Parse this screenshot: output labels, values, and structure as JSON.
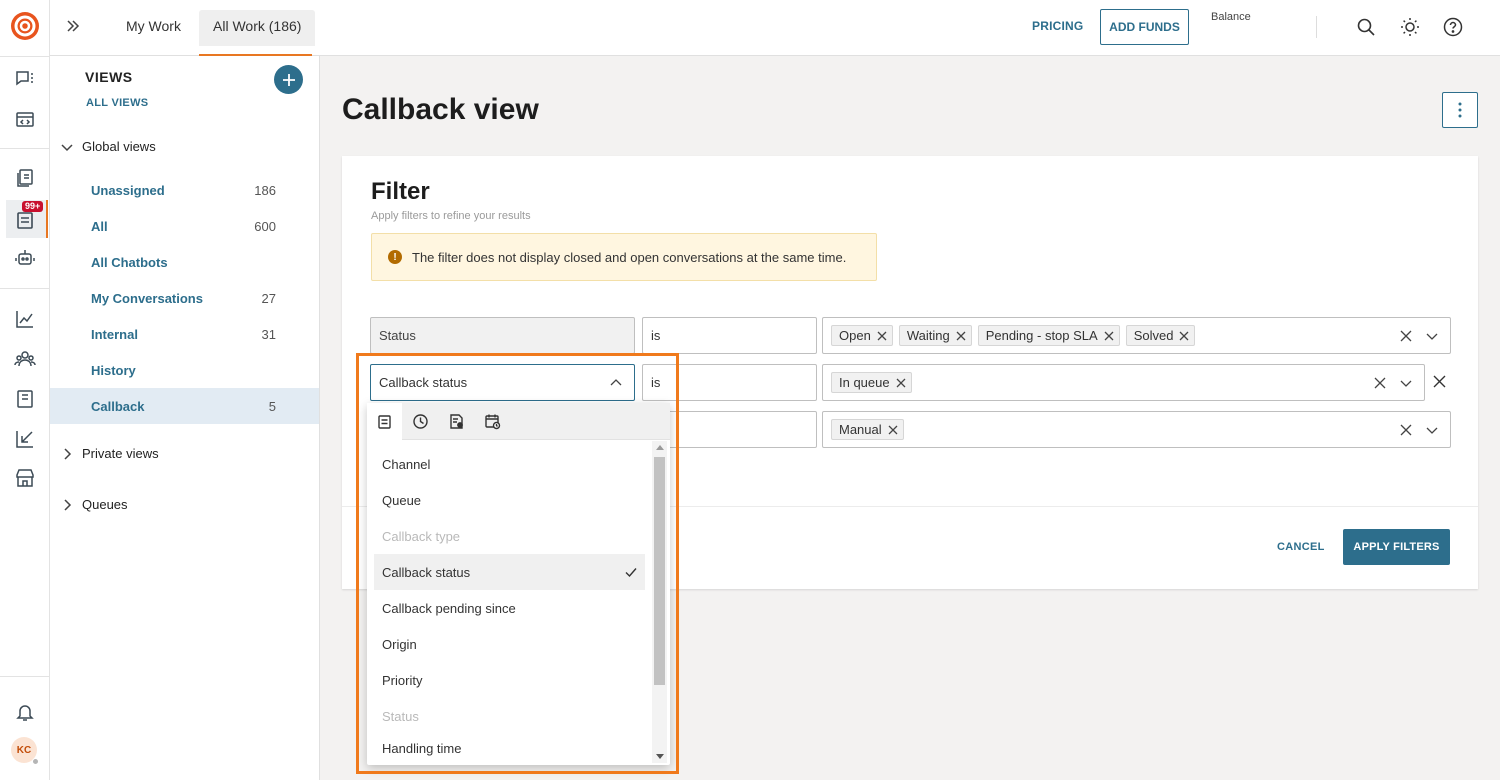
{
  "topbar": {
    "tabs": [
      {
        "label": "My Work",
        "active": false
      },
      {
        "label": "All Work (186)",
        "active": true
      }
    ],
    "pricing_label": "PRICING",
    "add_funds_label": "ADD FUNDS",
    "balance_label": "Balance"
  },
  "rail": {
    "badge": "99+",
    "avatar_initials": "KC",
    "icons": [
      "chat-icon",
      "code-icon",
      "knowledge-icon",
      "inbox-icon",
      "bot-icon",
      "analytics-icon",
      "people-icon",
      "book-icon",
      "import-icon",
      "store-icon",
      "bell-icon"
    ]
  },
  "views": {
    "title": "VIEWS",
    "all_views_label": "ALL VIEWS",
    "global_heading": "Global views",
    "items": [
      {
        "label": "Unassigned",
        "count": "186"
      },
      {
        "label": "All",
        "count": "600"
      },
      {
        "label": "All Chatbots",
        "count": ""
      },
      {
        "label": "My Conversations",
        "count": "27"
      },
      {
        "label": "Internal",
        "count": "31"
      },
      {
        "label": "History",
        "count": ""
      },
      {
        "label": "Callback",
        "count": "5",
        "active": true
      }
    ],
    "private_heading": "Private views",
    "queues_heading": "Queues"
  },
  "main": {
    "page_title": "Callback view",
    "filter": {
      "title": "Filter",
      "subtitle": "Apply filters to refine your results",
      "warning": "The filter does not display closed and open conversations at the same time.",
      "rows": [
        {
          "field": "Status",
          "operator": "is",
          "values": [
            "Open",
            "Waiting",
            "Pending - stop SLA",
            "Solved"
          ]
        },
        {
          "field": "Callback status",
          "operator": "is",
          "values": [
            "In queue"
          ]
        },
        {
          "field": "",
          "operator": "",
          "values": [
            "Manual"
          ]
        }
      ],
      "cancel_label": "CANCEL",
      "apply_label": "APPLY FILTERS"
    }
  },
  "dropdown": {
    "tab_icons": [
      "conversation-icon",
      "clock-icon",
      "document-settings-icon",
      "calendar-clock-icon"
    ],
    "items": [
      {
        "label": "Channel",
        "state": "normal"
      },
      {
        "label": "Queue",
        "state": "normal"
      },
      {
        "label": "Callback type",
        "state": "disabled"
      },
      {
        "label": "Callback status",
        "state": "selected"
      },
      {
        "label": "Callback pending since",
        "state": "normal"
      },
      {
        "label": "Origin",
        "state": "normal"
      },
      {
        "label": "Priority",
        "state": "normal"
      },
      {
        "label": "Status",
        "state": "disabled"
      },
      {
        "label": "Handling time",
        "state": "normal"
      }
    ]
  },
  "colors": {
    "accent": "#2d6e8c",
    "brand_orange": "#e87722",
    "highlight": "#f07a1c",
    "warning_bg": "#fff6e0"
  }
}
